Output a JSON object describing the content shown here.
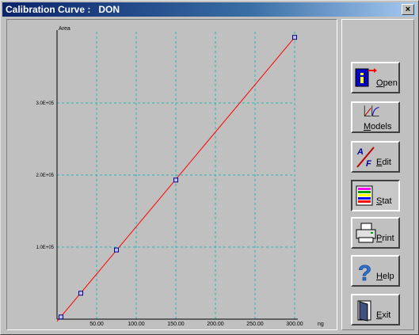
{
  "window": {
    "title": "Calibration Curve :   DON",
    "close_label": "×"
  },
  "buttons": [
    {
      "id": "open",
      "label": "Open"
    },
    {
      "id": "models",
      "label": "Models"
    },
    {
      "id": "edit",
      "label": "Edit"
    },
    {
      "id": "stat",
      "label": "Stat"
    },
    {
      "id": "print",
      "label": "Print"
    },
    {
      "id": "help",
      "label": "Help"
    },
    {
      "id": "exit",
      "label": "Exit"
    }
  ],
  "colors": {
    "grid": "#26b8b8",
    "line": "#ff0000",
    "marker": "#000080",
    "axis": "#000000"
  },
  "chart_data": {
    "type": "line",
    "xlabel": "ng",
    "ylabel": "Area",
    "xlim": [
      0,
      300
    ],
    "ylim": [
      0,
      400000
    ],
    "x_ticks": [
      50,
      100,
      150,
      200,
      250,
      300
    ],
    "x_tick_labels": [
      "50.00",
      "100.00",
      "150.00",
      "200.00",
      "250.00",
      "300.00"
    ],
    "y_ticks": [
      100000,
      200000,
      300000
    ],
    "y_tick_labels": [
      "1.0E+05",
      "2.0E+05",
      "3.0E+05"
    ],
    "grid": true,
    "fit_line": {
      "x": [
        0,
        300
      ],
      "y": [
        -3000,
        391000
      ]
    },
    "points": [
      {
        "x": 5,
        "y": 3000
      },
      {
        "x": 30,
        "y": 36000
      },
      {
        "x": 75,
        "y": 96000
      },
      {
        "x": 150,
        "y": 193000
      },
      {
        "x": 300,
        "y": 391000
      }
    ]
  }
}
